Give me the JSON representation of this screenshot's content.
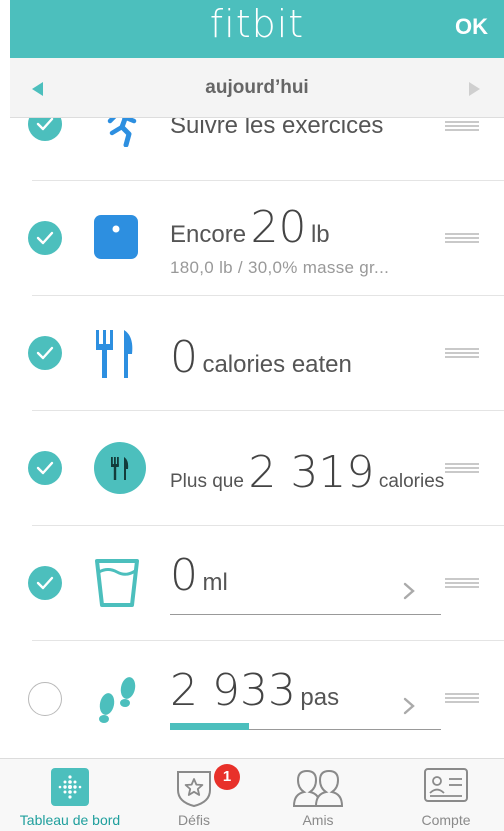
{
  "header": {
    "brand": "fitbit",
    "ok_label": "OK"
  },
  "datebar": {
    "label": "aujourd’hui"
  },
  "rows": [
    {
      "checked": true,
      "icon": "running-person-icon",
      "prefix": "Suivre les exercices"
    },
    {
      "checked": true,
      "icon": "scale-icon",
      "prefix": "Encore",
      "value": "20",
      "unit": "lb",
      "sub": "180,0 lb / 30,0% masse gr..."
    },
    {
      "checked": true,
      "icon": "fork-knife-icon",
      "value": "0",
      "unit": "calories eaten"
    },
    {
      "checked": true,
      "icon": "plate-icon",
      "prefix": "Plus que",
      "value": "2 319",
      "unit": "calories"
    },
    {
      "checked": true,
      "icon": "water-glass-icon",
      "value": "0",
      "unit": "ml"
    },
    {
      "checked": false,
      "icon": "footsteps-icon",
      "value": "2 933",
      "unit": "pas",
      "progress": 0.29
    }
  ],
  "tabbar": {
    "tabs": [
      {
        "label": "Tableau de bord",
        "icon": "dashboard-icon",
        "active": true
      },
      {
        "label": "Défis",
        "icon": "star-badge-icon",
        "badge": "1"
      },
      {
        "label": "Amis",
        "icon": "friends-icon"
      },
      {
        "label": "Compte",
        "icon": "account-card-icon"
      }
    ]
  },
  "colors": {
    "accent": "#4cbfbd",
    "icon_blue": "#2d8fe0",
    "badge_red": "#e8312a"
  }
}
